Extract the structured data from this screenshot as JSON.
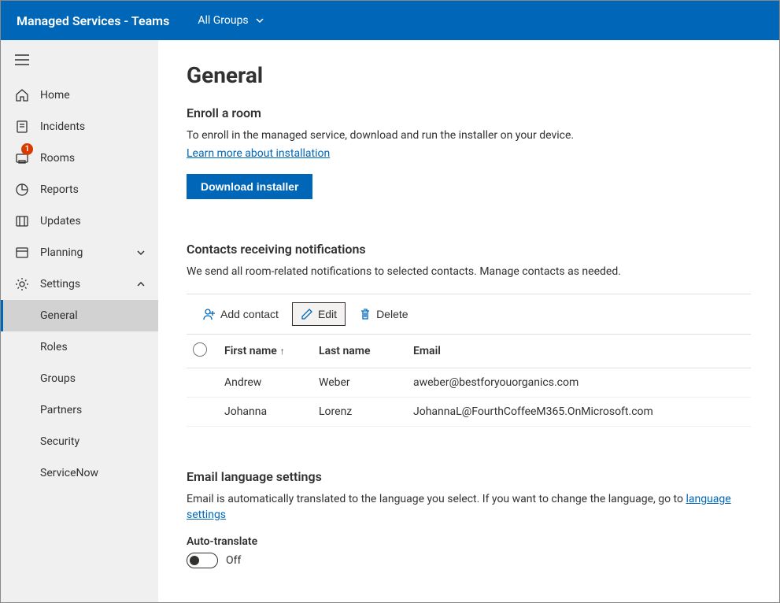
{
  "header": {
    "title": "Managed Services - Teams",
    "group_selector": "All Groups"
  },
  "sidebar": {
    "items": [
      {
        "label": "Home"
      },
      {
        "label": "Incidents",
        "badge": "1"
      },
      {
        "label": "Rooms"
      },
      {
        "label": "Reports"
      },
      {
        "label": "Updates"
      },
      {
        "label": "Planning",
        "expandable": true,
        "expanded": false
      },
      {
        "label": "Settings",
        "expandable": true,
        "expanded": true
      }
    ],
    "settings_children": [
      {
        "label": "General",
        "selected": true
      },
      {
        "label": "Roles"
      },
      {
        "label": "Groups"
      },
      {
        "label": "Partners"
      },
      {
        "label": "Security"
      },
      {
        "label": "ServiceNow"
      }
    ]
  },
  "page": {
    "title": "General",
    "enroll": {
      "heading": "Enroll a room",
      "text": "To enroll in the managed service, download and run the installer on your device.",
      "link": "Learn more about installation",
      "button": "Download installer"
    },
    "contacts_section": {
      "heading": "Contacts receiving notifications",
      "text": "We send all room-related notifications to selected contacts. Manage contacts as needed."
    },
    "toolbar": {
      "add_label": "Add contact",
      "edit_label": "Edit",
      "delete_label": "Delete"
    },
    "table": {
      "cols": {
        "first": "First name",
        "last": "Last name",
        "email": "Email"
      },
      "rows": [
        {
          "first": "Andrew",
          "last": "Weber",
          "email": "aweber@bestforyouorganics.com"
        },
        {
          "first": "Johanna",
          "last": "Lorenz",
          "email": "JohannaL@FourthCoffeeM365.OnMicrosoft.com"
        }
      ]
    },
    "lang": {
      "heading": "Email language settings",
      "text_before": "Email is automatically translated to the language you select. If you want to change the language, go to ",
      "link": "language settings",
      "toggle_label": "Auto-translate",
      "toggle_state": "Off"
    }
  }
}
